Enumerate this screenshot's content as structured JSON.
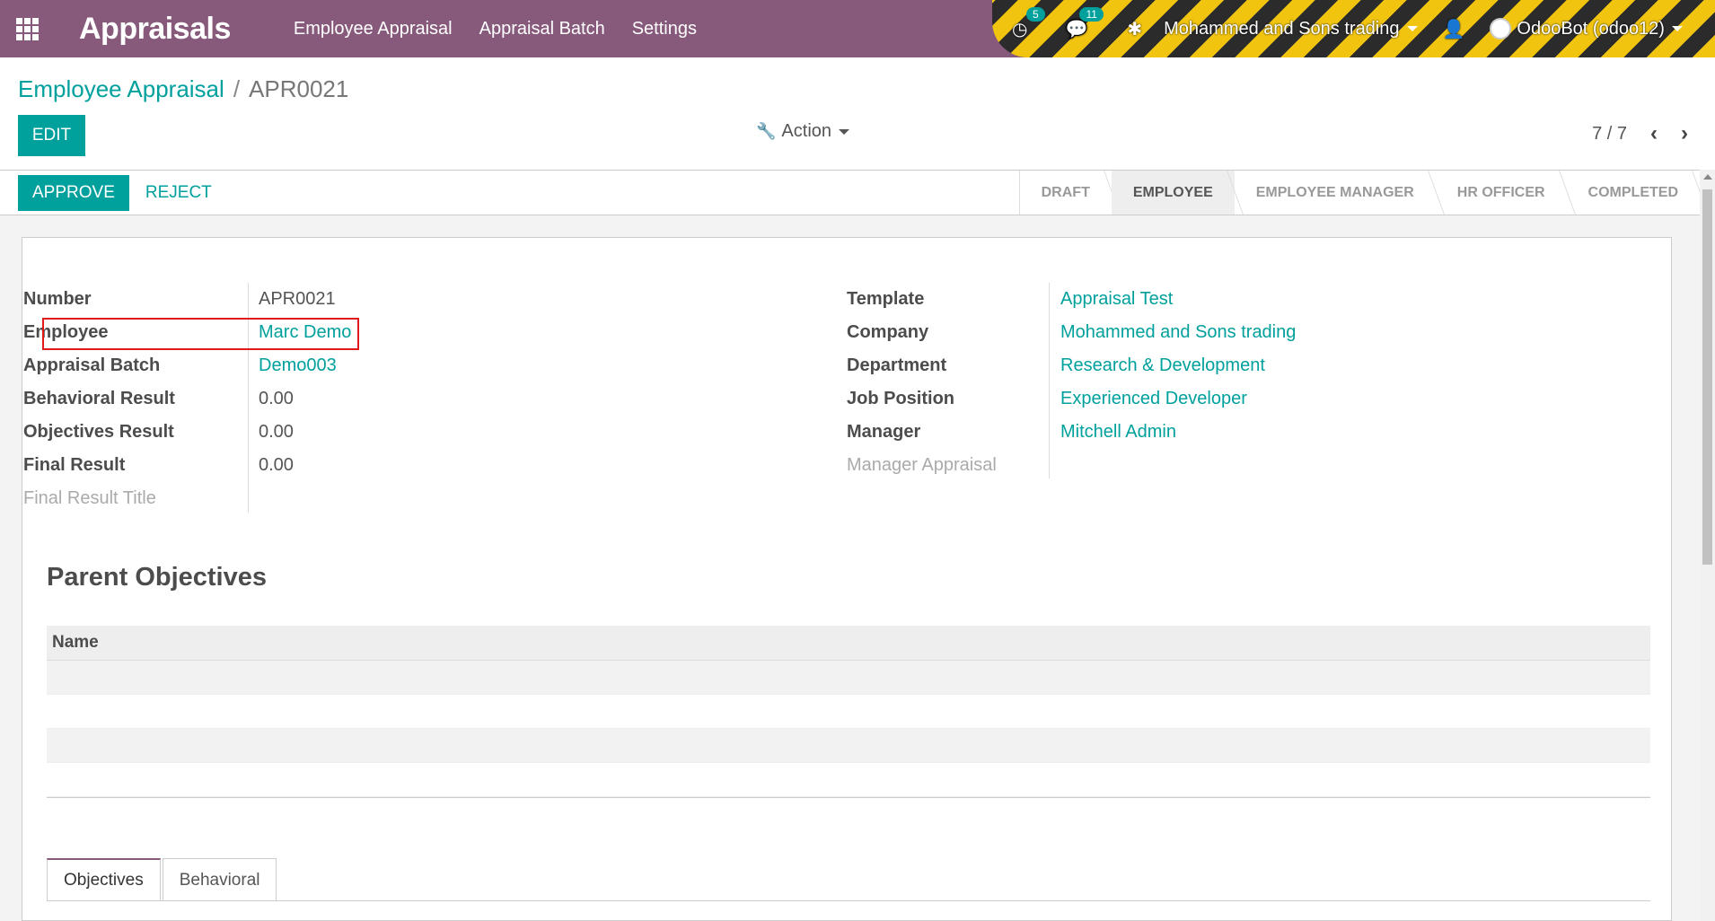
{
  "navbar": {
    "brand": "Appraisals",
    "menu": [
      "Employee Appraisal",
      "Appraisal Batch",
      "Settings"
    ],
    "activity_count": "5",
    "message_count": "11",
    "company": "Mohammed and Sons trading",
    "user": "OdooBot (odoo12)"
  },
  "control_panel": {
    "breadcrumb_parent": "Employee Appraisal",
    "breadcrumb_separator": "/",
    "breadcrumb_current": "APR0021",
    "edit_label": "EDIT",
    "action_label": "Action",
    "pager": "7 / 7"
  },
  "statusbar": {
    "approve_label": "APPROVE",
    "reject_label": "REJECT",
    "stages": [
      "DRAFT",
      "EMPLOYEE",
      "EMPLOYEE MANAGER",
      "HR OFFICER",
      "COMPLETED"
    ],
    "active_stage": "EMPLOYEE"
  },
  "form": {
    "left": [
      {
        "label": "Number",
        "value": "APR0021"
      },
      {
        "label": "Employee",
        "value": "Marc Demo"
      },
      {
        "label": "Appraisal Batch",
        "value": "Demo003"
      },
      {
        "label": "Behavioral Result",
        "value": "0.00"
      },
      {
        "label": "Objectives Result",
        "value": "0.00"
      },
      {
        "label": "Final Result",
        "value": "0.00"
      },
      {
        "label": "Final Result Title",
        "value": ""
      }
    ],
    "right": [
      {
        "label": "Template",
        "value": "Appraisal Test"
      },
      {
        "label": "Company",
        "value": "Mohammed and Sons trading"
      },
      {
        "label": "Department",
        "value": "Research & Development"
      },
      {
        "label": "Job Position",
        "value": "Experienced Developer"
      },
      {
        "label": "Manager",
        "value": "Mitchell Admin"
      },
      {
        "label": "Manager Appraisal",
        "value": ""
      }
    ]
  },
  "parent_objectives": {
    "title": "Parent Objectives",
    "column_name": "Name"
  },
  "tabs": [
    "Objectives",
    "Behavioral"
  ],
  "colors": {
    "navbar": "#875a7b",
    "accent": "#00a09d",
    "highlight_box": "#e0191b"
  }
}
